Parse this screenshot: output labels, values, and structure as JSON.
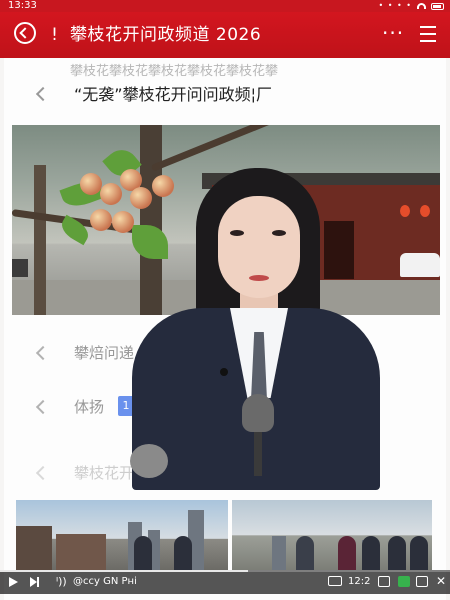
{
  "status_bar": {
    "time": "13:33",
    "signal_dots": "• • • •"
  },
  "header": {
    "pin_glyph": "ǃ",
    "title": "攀枝花开问政频道 2026",
    "more_glyph": "···"
  },
  "content": {
    "ghost_text": "攀枝花攀枝花攀枝花攀枝花攀枝花攀",
    "rows": [
      {
        "text": "“无袭”攀枝花开问问政频¦厂"
      },
      {
        "text": "攀焙问递 |"
      },
      {
        "text": "体扬",
        "badge": "1"
      },
      {
        "text": "攀枝花开问政"
      }
    ]
  },
  "player": {
    "volume_glyph": "ᑊ))",
    "label": "@ccy GN Рні",
    "time": "12:2",
    "progress_fraction": 0.55,
    "close_glyph": "✕"
  },
  "colors": {
    "brand_red": "#c8171f",
    "badge_blue": "#3a6ee8"
  },
  "icons": [
    "refresh-back-icon",
    "pin-icon",
    "more-icon",
    "share-icon",
    "chevron-left-icon",
    "play-icon",
    "next-icon",
    "volume-icon",
    "captions-icon",
    "fullscreen-icon",
    "close-icon"
  ]
}
